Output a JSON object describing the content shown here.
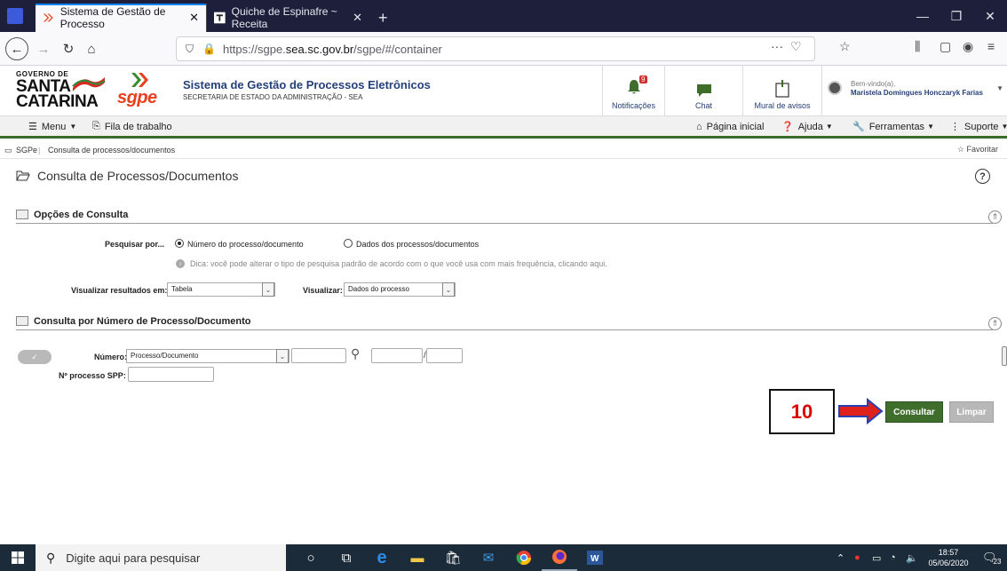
{
  "browser": {
    "tabs": [
      {
        "label": "Sistema de Gestão de Processo",
        "active": true
      },
      {
        "label": "Quiche de Espinafre ~ Receita",
        "active": false
      }
    ],
    "new_tab": "+",
    "url_prefix": "https://sgpe.",
    "url_domain": "sea.sc.gov.br",
    "url_path": "/sgpe/#/container",
    "url_actions": "···",
    "window_controls": [
      "—",
      "❐",
      "✕"
    ]
  },
  "header": {
    "gov_line1": "GOVERNO DE",
    "gov_line2": "SANTA",
    "gov_line3": "CATARINA",
    "sgpe_logo": "sgpe",
    "system_title": "Sistema de Gestão de Processos Eletrônicos",
    "system_subtitle": "SECRETARIA DE ESTADO DA ADMINISTRAÇÃO - SEA",
    "notifications_label": "Notificações",
    "notifications_count": "9",
    "chat_label": "Chat",
    "mural_label": "Mural de avisos",
    "welcome": "Bem-vindo(a),",
    "user_name": "Maristela Domingues Honczaryk Farias"
  },
  "menubar": {
    "menu": "Menu",
    "work_queue": "Fila de trabalho",
    "home": "Página inicial",
    "help": "Ajuda",
    "tools": "Ferramentas",
    "support": "Suporte"
  },
  "breadcrumb": {
    "root": "SGPe",
    "current": "Consulta de processos/documentos",
    "favorite": "Favoritar"
  },
  "page": {
    "title": "Consulta de Processos/Documentos",
    "help_icon": "?"
  },
  "options": {
    "section_title": "Opções de Consulta",
    "search_by_label": "Pesquisar por...",
    "radio_number": "Número do processo/documento",
    "radio_data": "Dados dos processos/documentos",
    "tip": "Dica: você pode alterar o tipo de pesquisa padrão de acordo com o que você usa com mais frequência, clicando aqui.",
    "view_results_label": "Visualizar resultados em:",
    "view_results_value": "Tabela",
    "view_label": "Visualizar:",
    "view_value": "Dados do processo"
  },
  "number_query": {
    "section_title": "Consulta por Número de Processo/Documento",
    "number_label": "Número:",
    "number_type_value": "Processo/Documento",
    "slash": "/",
    "spp_label": "Nº processo SPP:",
    "toggle_check": "✓"
  },
  "actions": {
    "consult": "Consultar",
    "clear": "Limpar"
  },
  "annotation": {
    "step": "10"
  },
  "taskbar": {
    "search_placeholder": "Digite aqui para pesquisar",
    "time": "18:57",
    "date": "05/06/2020",
    "notif_count": "23"
  }
}
